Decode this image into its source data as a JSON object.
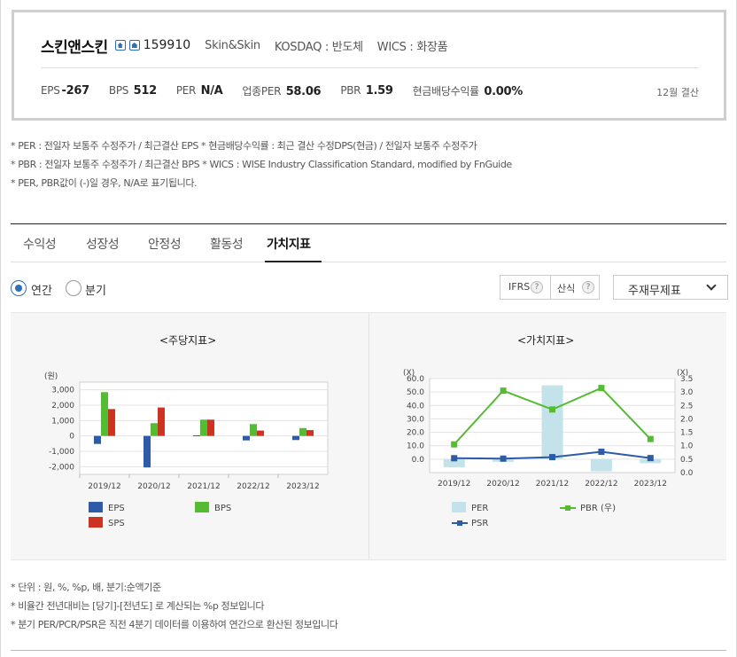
{
  "company": {
    "name": "스킨앤스킨",
    "code": "159910",
    "english_name": "Skin&Skin",
    "market": "KOSDAQ : 반도체",
    "wics": "WICS : 화장품"
  },
  "metrics": [
    {
      "label": "EPS",
      "value": "-267"
    },
    {
      "label": "BPS",
      "value": "512"
    },
    {
      "label": "PER",
      "value": "N/A"
    },
    {
      "label": "업종PER",
      "value": "58.06"
    },
    {
      "label": "PBR",
      "value": "1.59"
    },
    {
      "label": "현금배당수익률",
      "value": "0.00%"
    }
  ],
  "settlement": "12월 결산",
  "notes_top": [
    "* PER : 전일자 보통주 수정주가 / 최근결산 EPS * 현금배당수익률 : 최근 결산 수정DPS(현금) / 전일자 보통주 수정주가",
    "* PBR : 전일자 보통주 수정주가 / 최근결산 BPS * WICS : WISE Industry Classification Standard, modified by FnGuide",
    "* PER, PBR값이 (-)일 경우, N/A로 표기됩니다."
  ],
  "tabs": [
    "수익성",
    "성장성",
    "안정성",
    "활동성",
    "가치지표"
  ],
  "active_tab": 4,
  "period_options": [
    "연간",
    "분기"
  ],
  "selected_period": 0,
  "ifrs_label": "IFRS",
  "calc_label": "산식",
  "help_glyph": "?",
  "statement_select": "주재무제표",
  "notes_bottom": [
    "* 단위 : 원, %, %p, 배, 분기:순액기준",
    "* 비율간 전년대비는 [당기]-[전년도] 로 계산되는 %p 정보입니다",
    "* 분기 PER/PCR/PSR은 직전 4분기 데이터를 이용하여 연간으로 환산된 정보입니다"
  ],
  "chart_data": [
    {
      "type": "bar",
      "title": "<주당지표>",
      "ylabel": "(원)",
      "ylim": [
        -2500,
        3500
      ],
      "yticks": [
        3000,
        2000,
        1000,
        0,
        -1000,
        -2000
      ],
      "ytick_labels": [
        "3,000",
        "2,000",
        "1,000",
        "0",
        "-1,000",
        "-2,000"
      ],
      "categories": [
        "2019/12",
        "2020/12",
        "2021/12",
        "2022/12",
        "2023/12"
      ],
      "grid": true,
      "legend": "bottom",
      "series": [
        {
          "name": "EPS",
          "color": "#2e5ba8",
          "values": [
            -520,
            -2050,
            40,
            -290,
            -267
          ]
        },
        {
          "name": "BPS",
          "color": "#55bb33",
          "values": [
            2850,
            830,
            1060,
            770,
            512
          ]
        },
        {
          "name": "SPS",
          "color": "#cc3322",
          "values": [
            1750,
            1850,
            1060,
            350,
            380
          ]
        }
      ]
    },
    {
      "type": "line",
      "title": "<가치지표>",
      "ylabel_left": "(X)",
      "ylabel_right": "(X)",
      "ylim_left": [
        -10,
        60
      ],
      "yticks_left": [
        60,
        50,
        40,
        30,
        20,
        10,
        0
      ],
      "ytick_labels_left": [
        "60.0",
        "50.0",
        "40.0",
        "30.0",
        "20.0",
        "10.0",
        "0.0"
      ],
      "ylim_right": [
        0,
        3.5
      ],
      "yticks_right": [
        3.5,
        3.0,
        2.5,
        2.0,
        1.5,
        1.0,
        0.5,
        0.0
      ],
      "ytick_labels_right": [
        "3.5",
        "3.0",
        "2.5",
        "2.0",
        "1.5",
        "1.0",
        "0.5",
        "0.0"
      ],
      "categories": [
        "2019/12",
        "2020/12",
        "2021/12",
        "2022/12",
        "2023/12"
      ],
      "grid": true,
      "legend": "bottom",
      "series": [
        {
          "name": "PER",
          "kind": "bar",
          "axis": "left",
          "color": "#c3e2ea",
          "values": [
            -6,
            -2,
            55,
            -9,
            -3
          ]
        },
        {
          "name": "PBR (우)",
          "kind": "line",
          "axis": "right",
          "color": "#55bb33",
          "values": [
            1.05,
            3.05,
            2.35,
            3.15,
            1.25
          ]
        },
        {
          "name": "PSR",
          "kind": "line",
          "axis": "left",
          "color": "#2e5ba8",
          "values": [
            0.7,
            0.4,
            1.5,
            5.5,
            0.8
          ]
        }
      ]
    }
  ]
}
